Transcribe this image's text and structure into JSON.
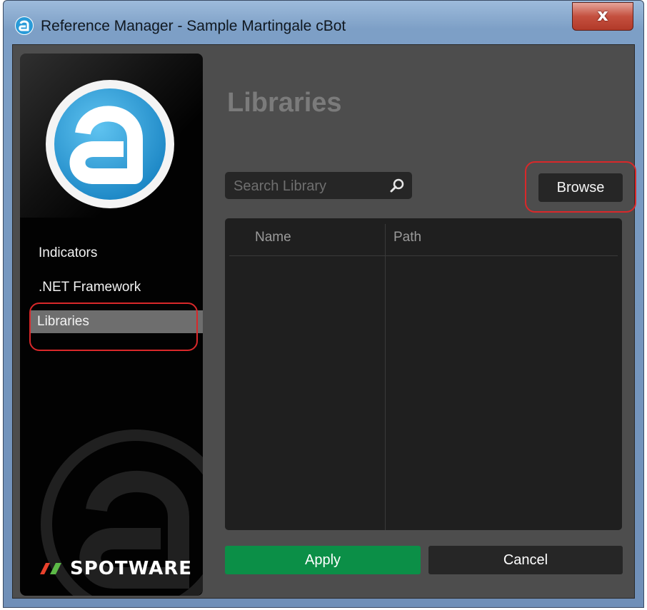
{
  "window": {
    "title": "Reference Manager - Sample Martingale cBot",
    "close_label": "x"
  },
  "sidebar": {
    "items": [
      {
        "label": "Indicators",
        "selected": false
      },
      {
        "label": ".NET Framework",
        "selected": false
      },
      {
        "label": "Libraries",
        "selected": true
      }
    ],
    "brand": "SPOTWARE"
  },
  "main": {
    "title": "Libraries",
    "search": {
      "placeholder": "Search Library",
      "value": ""
    },
    "browse_label": "Browse",
    "table": {
      "columns": [
        "Name",
        "Path"
      ],
      "rows": []
    },
    "apply_label": "Apply",
    "cancel_label": "Cancel"
  },
  "colors": {
    "accent_green": "#0b8f47",
    "logo_blue": "#2a9bd8",
    "highlight_red": "#d9282a",
    "brand_red": "#e8412c",
    "brand_green": "#5cb947"
  },
  "icons": {
    "app": "calgo-logo-icon",
    "search": "search-icon",
    "close": "close-icon"
  }
}
